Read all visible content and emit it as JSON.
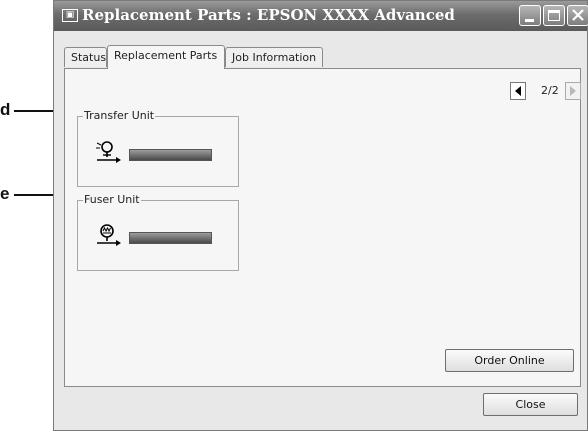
{
  "callouts": {
    "d": "d",
    "e": "e"
  },
  "window": {
    "title": "Replacement Parts : EPSON XXXX Advanced",
    "icon": "printer-icon"
  },
  "tabs": [
    {
      "label": "Status",
      "active": false
    },
    {
      "label": "Replacement Parts",
      "active": true
    },
    {
      "label": "Job Information",
      "active": false
    }
  ],
  "pager": {
    "text": "2/2"
  },
  "parts": [
    {
      "label": "Transfer Unit",
      "icon": "transfer-unit-icon",
      "level": 1.0
    },
    {
      "label": "Fuser Unit",
      "icon": "fuser-unit-icon",
      "level": 1.0
    }
  ],
  "buttons": {
    "order_online": "Order Online",
    "close": "Close"
  }
}
